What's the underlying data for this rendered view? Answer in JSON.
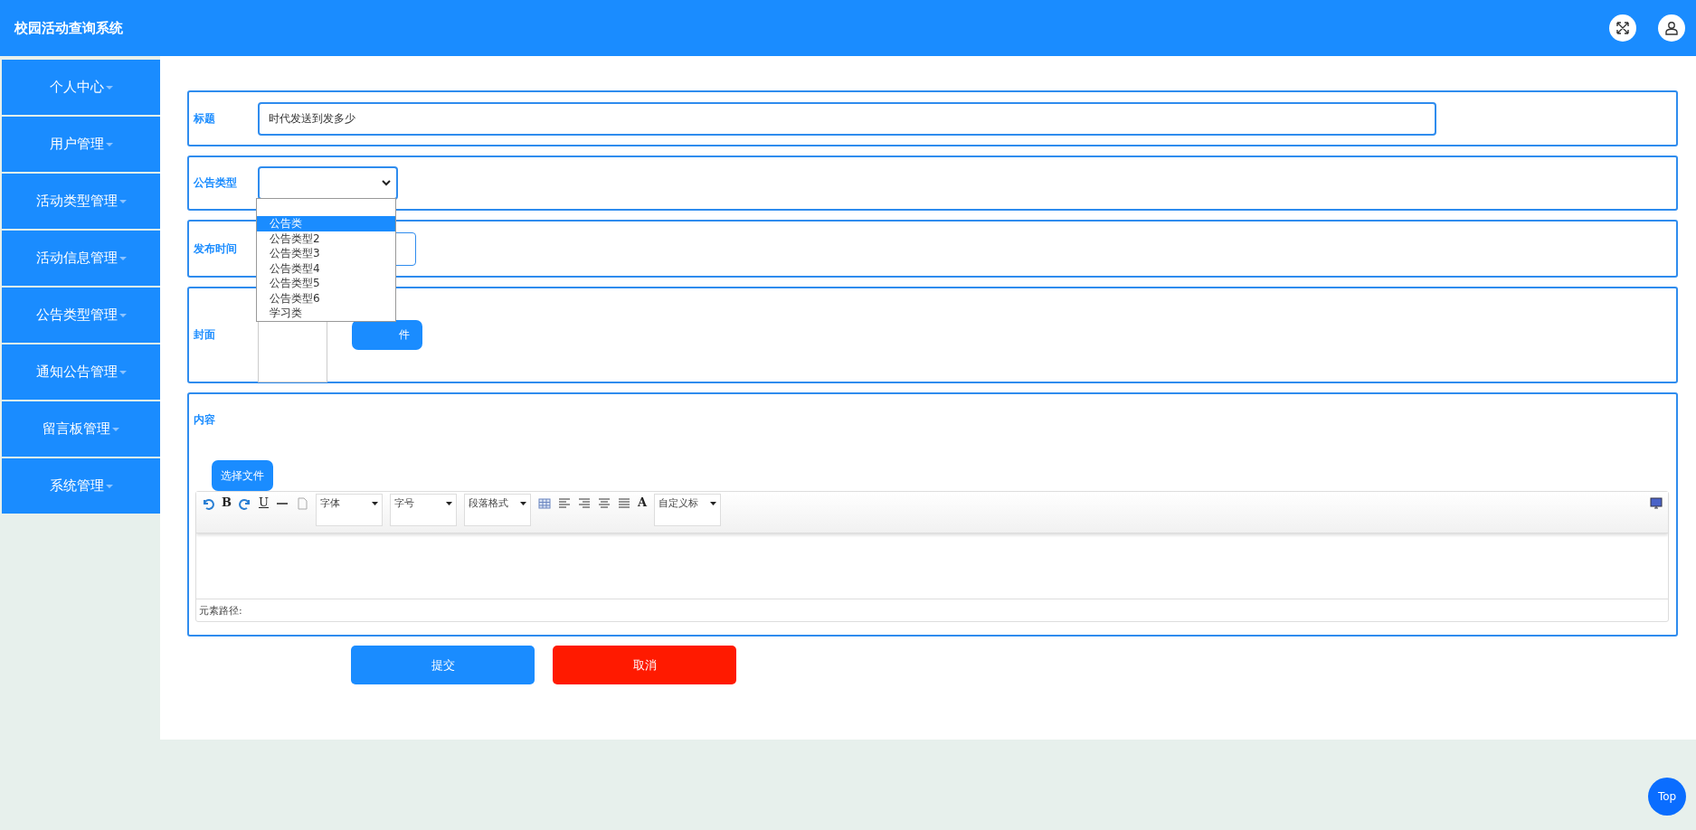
{
  "header": {
    "title": "校园活动查询系统"
  },
  "sidebar": {
    "items": [
      {
        "label": "个人中心"
      },
      {
        "label": "用户管理"
      },
      {
        "label": "活动类型管理"
      },
      {
        "label": "活动信息管理"
      },
      {
        "label": "公告类型管理"
      },
      {
        "label": "通知公告管理"
      },
      {
        "label": "留言板管理"
      },
      {
        "label": "系统管理"
      }
    ]
  },
  "form": {
    "title": {
      "label": "标题",
      "value": "时代发送到发多少"
    },
    "type": {
      "label": "公告类型",
      "options": [
        {
          "label": "公告类",
          "selected": true
        },
        {
          "label": "公告类型2",
          "selected": false
        },
        {
          "label": "公告类型3",
          "selected": false
        },
        {
          "label": "公告类型4",
          "selected": false
        },
        {
          "label": "公告类型5",
          "selected": false
        },
        {
          "label": "公告类型6",
          "selected": false
        },
        {
          "label": "学习类",
          "selected": false
        }
      ]
    },
    "time": {
      "label": "发布时间"
    },
    "cover": {
      "label": "封面",
      "button": "件"
    },
    "content": {
      "label": "内容",
      "button": "选择文件",
      "editor": {
        "bold": "B",
        "underline": "U",
        "combos": [
          "字体",
          "字号",
          "段落格式"
        ],
        "font_color_label": "A",
        "heading": "自定义标",
        "path": "元素路径:"
      }
    }
  },
  "buttons": {
    "submit": "提交",
    "cancel": "取消"
  },
  "top_button": "Top"
}
